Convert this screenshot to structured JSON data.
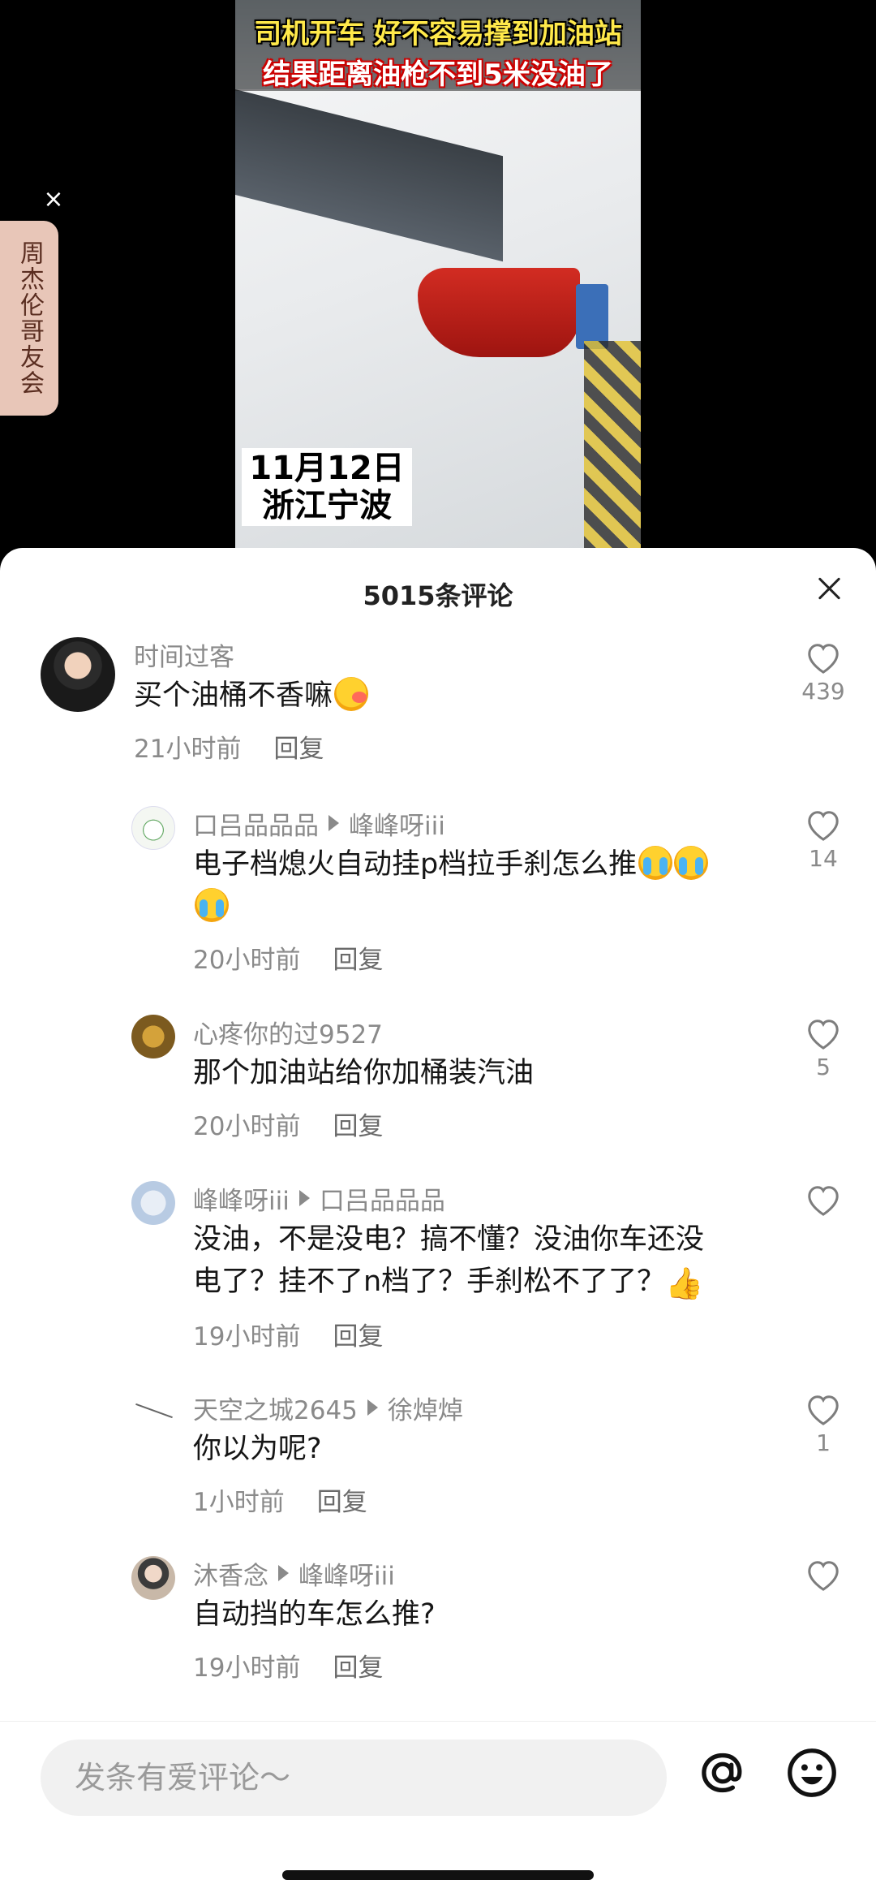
{
  "video": {
    "caption_line1": "司机开车 好不容易撑到加油站",
    "caption_line2": "结果距离油枪不到5米没油了",
    "date_line1": "11月12日",
    "date_line2": "浙江宁波"
  },
  "side_tab": {
    "label": "周杰伦哥友会",
    "close": "×"
  },
  "sheet": {
    "title": "5015条评论"
  },
  "comments": [
    {
      "user": "时间过客",
      "reply_to": "",
      "text": "买个油桶不香嘛",
      "time": "21小时前",
      "reply_label": "回复",
      "likes": "439",
      "emoji": "blush"
    },
    {
      "user": "口吕品品品",
      "reply_to": "峰峰呀iii",
      "text": "电子档熄火自动挂p档拉手刹怎么推",
      "time": "20小时前",
      "reply_label": "回复",
      "likes": "14",
      "emoji": "cry"
    },
    {
      "user": "心疼你的过9527",
      "reply_to": "",
      "text": "那个加油站给你加桶装汽油",
      "time": "20小时前",
      "reply_label": "回复",
      "likes": "5"
    },
    {
      "user": "峰峰呀iii",
      "reply_to": "口吕品品品",
      "text_line1": "没油，不是没电？搞不懂？没油你车还没",
      "text_line2": "电了？挂不了n档了？手刹松不了了？",
      "time": "19小时前",
      "reply_label": "回复",
      "likes": ""
    },
    {
      "user": "天空之城2645",
      "reply_to": "徐焯焯",
      "text": "你以为呢?",
      "time": "1小时前",
      "reply_label": "回复",
      "likes": "1"
    },
    {
      "user": "沐香念",
      "reply_to": "峰峰呀iii",
      "text": "自动挡的车怎么推?",
      "time": "19小时前",
      "reply_label": "回复",
      "likes": ""
    }
  ],
  "input": {
    "placeholder": "发条有爱评论～"
  },
  "icons": {
    "like": "heart-outline-icon",
    "close": "close-icon",
    "mention": "at-icon",
    "emoji": "smile-icon"
  }
}
